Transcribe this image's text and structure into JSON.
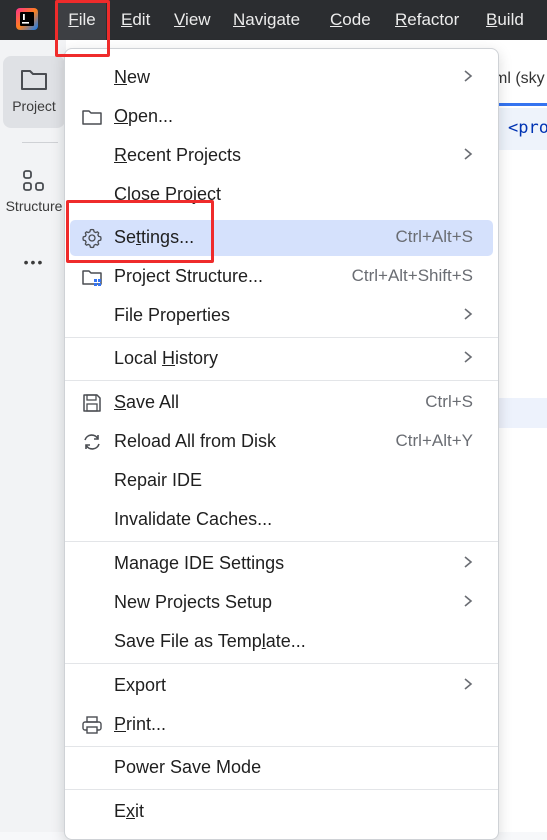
{
  "menubar": {
    "items": [
      {
        "pre": "",
        "mn": "F",
        "post": "ile"
      },
      {
        "pre": "",
        "mn": "E",
        "post": "dit"
      },
      {
        "pre": "",
        "mn": "V",
        "post": "iew"
      },
      {
        "pre": "",
        "mn": "N",
        "post": "avigate"
      },
      {
        "pre": "",
        "mn": "C",
        "post": "ode"
      },
      {
        "pre": "",
        "mn": "R",
        "post": "efactor"
      },
      {
        "pre": "",
        "mn": "B",
        "post": "uild"
      }
    ]
  },
  "toolstrip": {
    "project_label": "Project",
    "structure_label": "Structure",
    "more_label": "•••"
  },
  "editor": {
    "tab_text": "ml (sky",
    "code_text": "<pro"
  },
  "file_menu": {
    "new": {
      "pre": "",
      "mn": "N",
      "post": "ew"
    },
    "open": {
      "pre": "",
      "mn": "O",
      "post": "pen..."
    },
    "recent": {
      "pre": "",
      "mn": "R",
      "post": "ecent Projects"
    },
    "close": {
      "pre": "Close Pro",
      "mn": "j",
      "post": "ect"
    },
    "settings": {
      "pre": "Se",
      "mn": "t",
      "post": "tings...",
      "shortcut": "Ctrl+Alt+S"
    },
    "project_structure": {
      "label": "Project Structure...",
      "shortcut": "Ctrl+Alt+Shift+S"
    },
    "file_properties": {
      "label": "File Properties"
    },
    "local_history": {
      "pre": "Local ",
      "mn": "H",
      "post": "istory"
    },
    "save_all": {
      "pre": "",
      "mn": "S",
      "post": "ave All",
      "shortcut": "Ctrl+S"
    },
    "reload": {
      "label": "Reload All from Disk",
      "shortcut": "Ctrl+Alt+Y"
    },
    "repair": {
      "label": "Repair IDE"
    },
    "invalidate": {
      "label": "Invalidate Caches..."
    },
    "manage_settings": {
      "label": "Manage IDE Settings"
    },
    "new_projects_setup": {
      "label": "New Projects Setup"
    },
    "save_template": {
      "pre": "Save File as Temp",
      "mn": "l",
      "post": "ate..."
    },
    "export": {
      "label": "Export"
    },
    "print": {
      "pre": "",
      "mn": "P",
      "post": "rint..."
    },
    "power_save": {
      "label": "Power Save Mode"
    },
    "exit": {
      "pre": "E",
      "mn": "x",
      "post": "it"
    }
  },
  "colors": {
    "accent": "#3574f0",
    "highlight": "#d5e1fc",
    "annotation_red": "#ef2b2b",
    "titlebar": "#2b2d30"
  }
}
